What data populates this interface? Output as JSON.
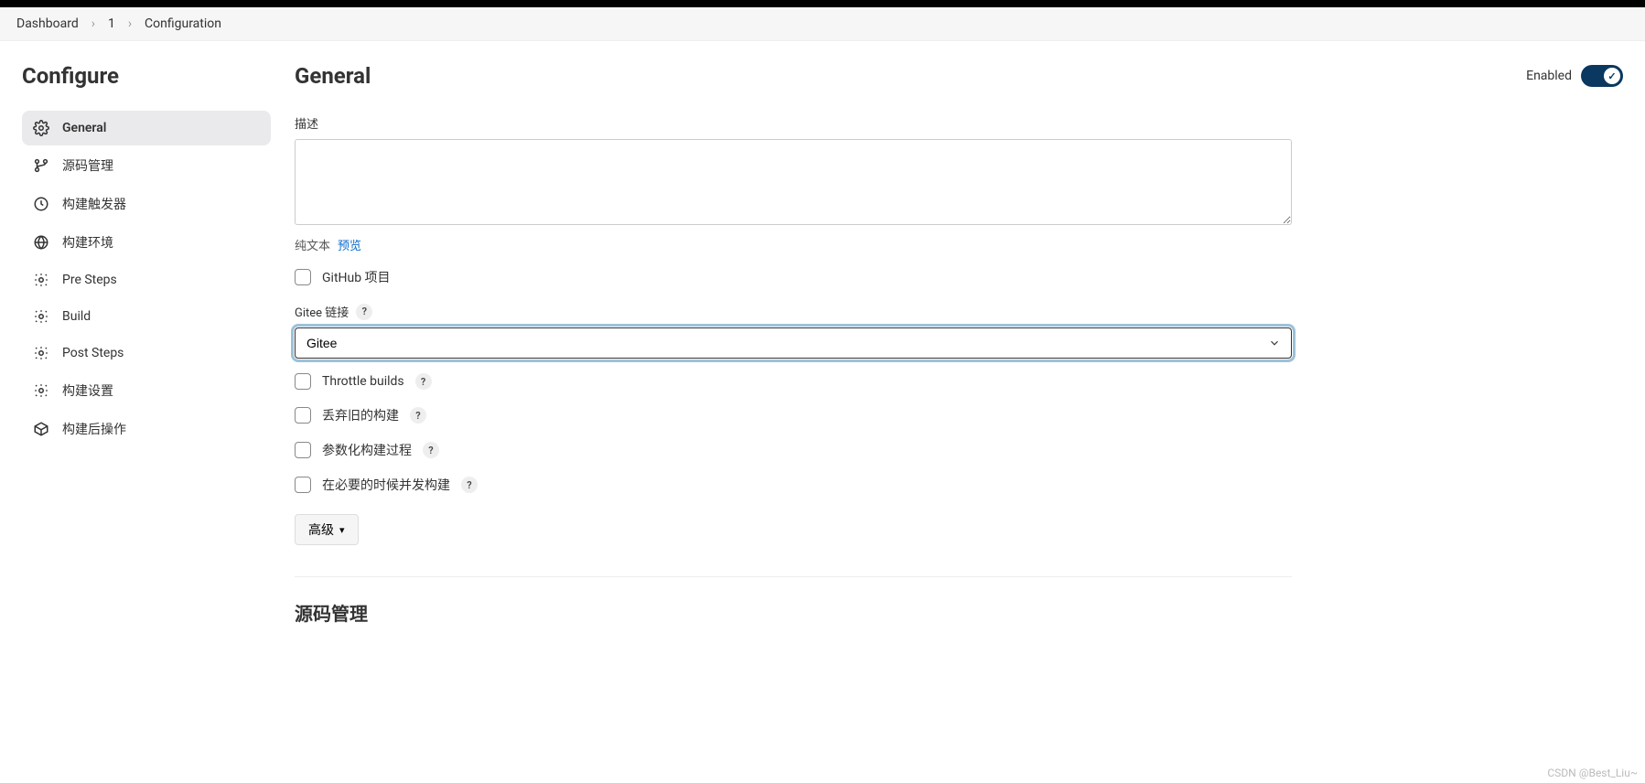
{
  "breadcrumb": {
    "items": [
      "Dashboard",
      "1",
      "Configuration"
    ]
  },
  "sidebar": {
    "title": "Configure",
    "items": [
      {
        "label": "General",
        "icon": "gear-icon",
        "active": true
      },
      {
        "label": "源码管理",
        "icon": "branch-icon",
        "active": false
      },
      {
        "label": "构建触发器",
        "icon": "clock-icon",
        "active": false
      },
      {
        "label": "构建环境",
        "icon": "globe-icon",
        "active": false
      },
      {
        "label": "Pre Steps",
        "icon": "gear-icon",
        "active": false
      },
      {
        "label": "Build",
        "icon": "gear-icon",
        "active": false
      },
      {
        "label": "Post Steps",
        "icon": "gear-icon",
        "active": false
      },
      {
        "label": "构建设置",
        "icon": "gear-icon",
        "active": false
      },
      {
        "label": "构建后操作",
        "icon": "box-icon",
        "active": false
      }
    ]
  },
  "main": {
    "heading": "General",
    "enabled_label": "Enabled",
    "description_label": "描述",
    "description_value": "",
    "format_plain": "纯文本",
    "format_preview": "预览",
    "checkbox_github": "GitHub 项目",
    "gitee_label": "Gitee 链接",
    "gitee_selected": "Gitee",
    "checkbox_throttle": "Throttle builds",
    "checkbox_discard": "丢弃旧的构建",
    "checkbox_param": "参数化构建过程",
    "checkbox_concurrent": "在必要的时候并发构建",
    "advanced_label": "高级",
    "section_scm_title": "源码管理"
  },
  "watermark": "CSDN @Best_Liu~"
}
